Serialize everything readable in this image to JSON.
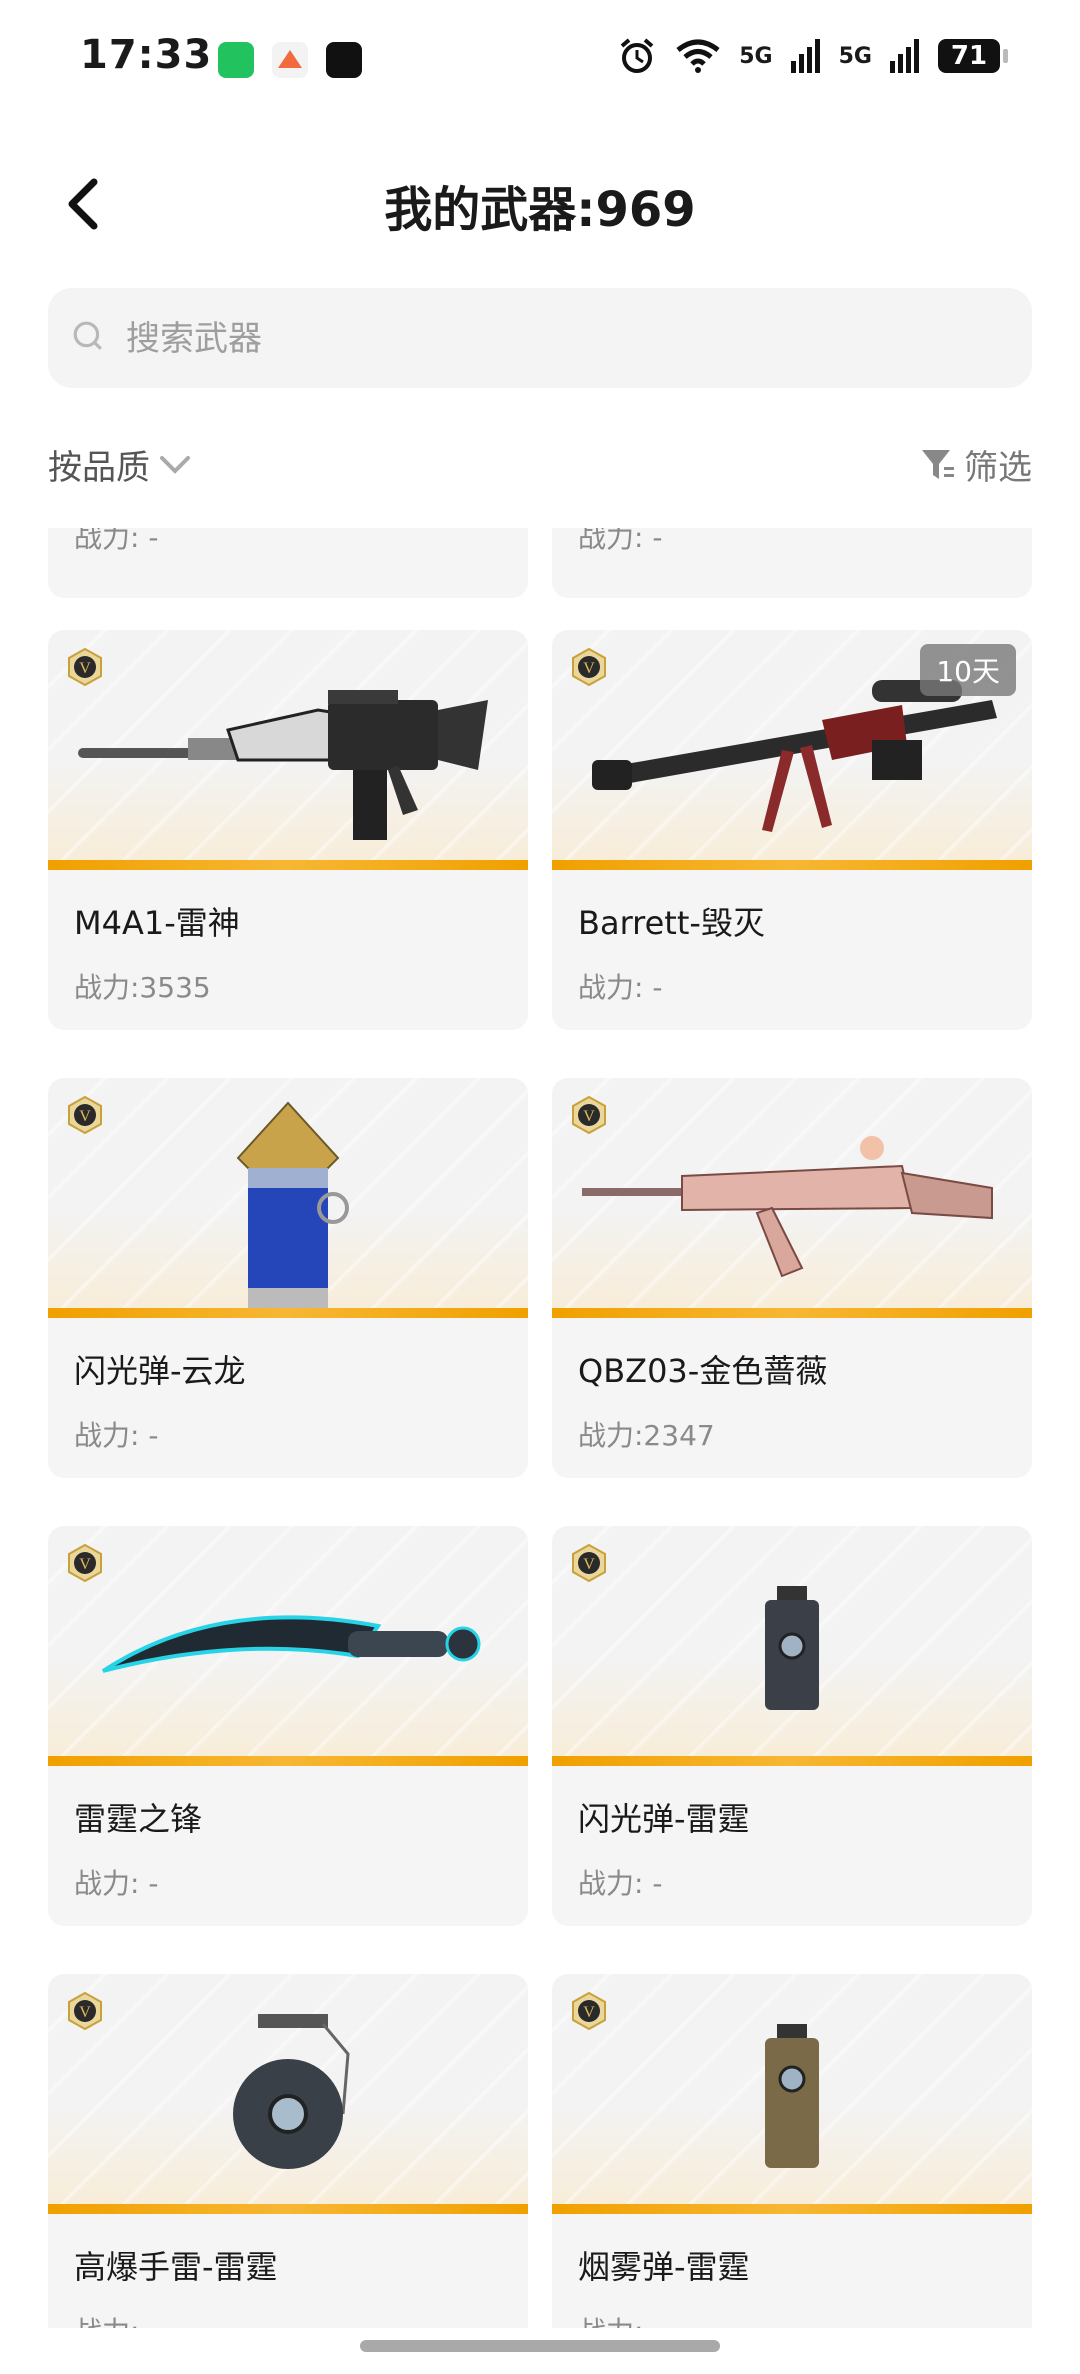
{
  "status_bar": {
    "time": "17:33",
    "signal1": "5G",
    "signal2": "5G",
    "battery": "71"
  },
  "header": {
    "title": "我的武器:969"
  },
  "search": {
    "placeholder": "搜索武器"
  },
  "toolbar": {
    "sort_label": "按品质",
    "filter_label": "筛选"
  },
  "partial_top": {
    "left_power": "战力: -",
    "right_power": "战力: -"
  },
  "weapons": [
    {
      "name": "M4A1-雷神",
      "power": "战力:3535",
      "tag": ""
    },
    {
      "name": "Barrett-毁灭",
      "power": "战力: -",
      "tag": "10天"
    },
    {
      "name": "闪光弹-云龙",
      "power": "战力: -",
      "tag": ""
    },
    {
      "name": "QBZ03-金色蔷薇",
      "power": "战力:2347",
      "tag": ""
    },
    {
      "name": "雷霆之锋",
      "power": "战力: -",
      "tag": ""
    },
    {
      "name": "闪光弹-雷霆",
      "power": "战力: -",
      "tag": ""
    },
    {
      "name": "高爆手雷-雷霆",
      "power": "战力:",
      "tag": ""
    },
    {
      "name": "烟雾弹-雷霆",
      "power": "战力:",
      "tag": ""
    }
  ],
  "colors": {
    "accent_gold": "#f0a000",
    "card_bg": "#f5f5f5",
    "badge_gold": "#c9a03a"
  },
  "icons": {
    "back": "chevron-left-icon",
    "search": "search-icon",
    "sort": "chevron-down-icon",
    "filter": "funnel-icon",
    "badge": "v-badge-icon"
  }
}
